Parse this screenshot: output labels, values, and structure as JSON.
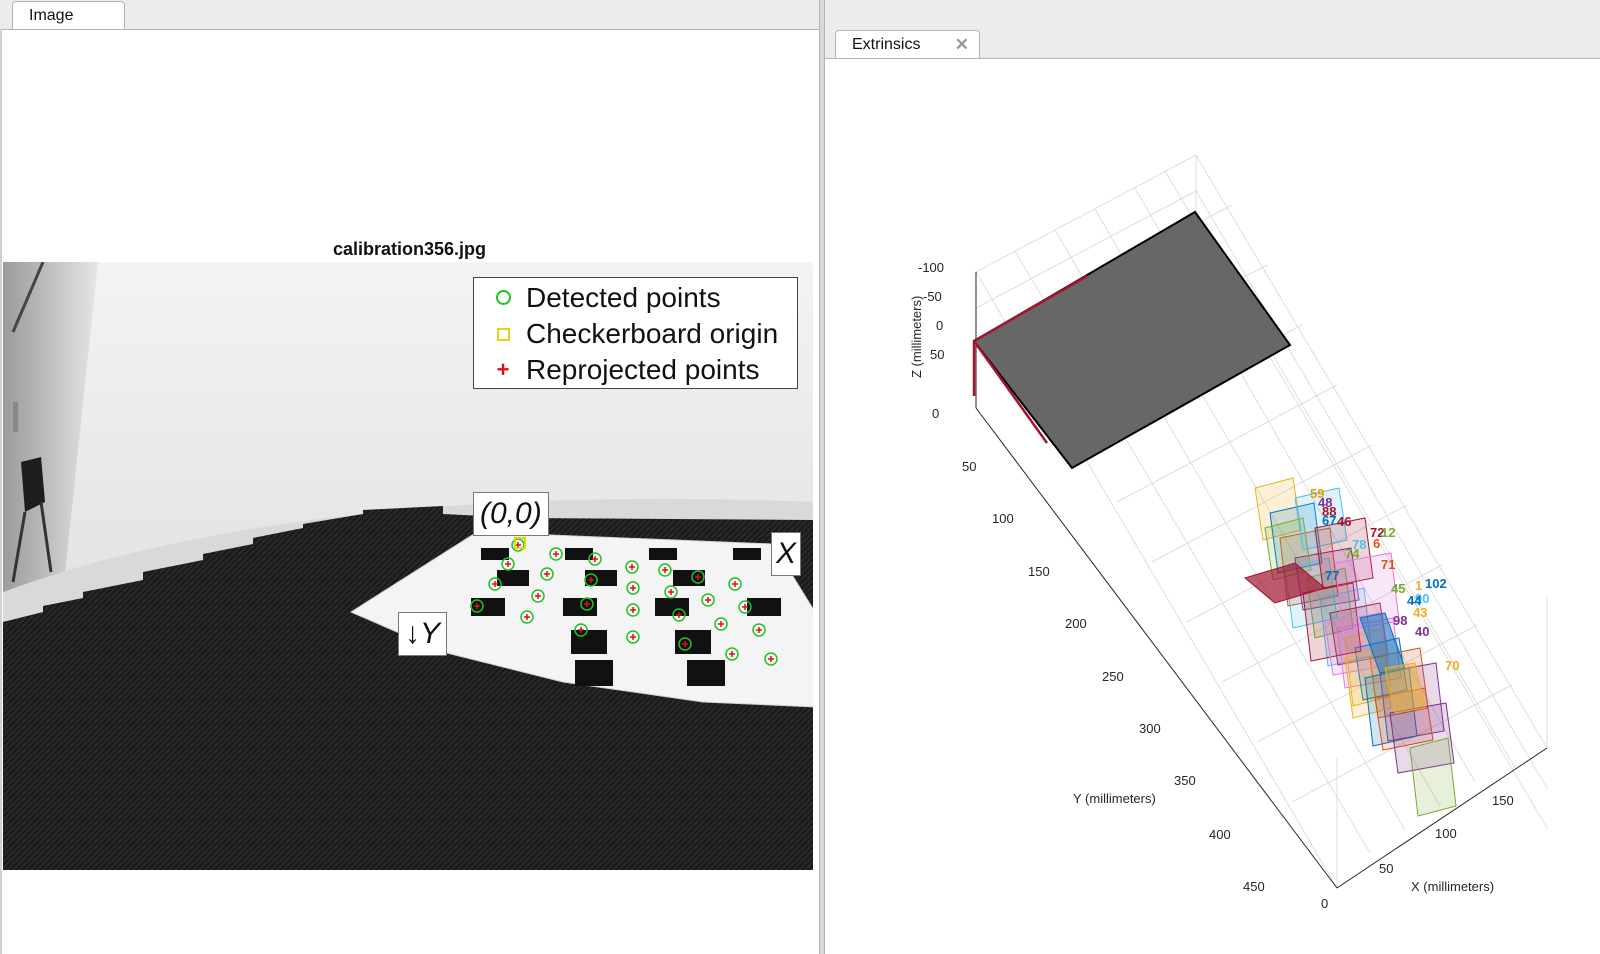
{
  "left_tab": {
    "label": "Image"
  },
  "right_tab": {
    "label": "Extrinsics"
  },
  "image_view": {
    "title": "calibration356.jpg",
    "legend": {
      "detected": "Detected points",
      "origin": "Checkerboard origin",
      "reprojected": "Reprojected points"
    },
    "origin_label": "(0,0)",
    "x_label": "X",
    "y_label": "↓Y"
  },
  "extrinsics_plot": {
    "z_label": "Z (millimeters)",
    "y_label": "Y (millimeters)",
    "x_label": "X (millimeters)",
    "z_ticks": [
      "-100",
      "-50",
      "0",
      "50",
      "0"
    ],
    "y_ticks": [
      "50",
      "100",
      "150",
      "200",
      "250",
      "300",
      "350",
      "400",
      "450"
    ],
    "x_ticks": [
      "0",
      "50",
      "100",
      "150"
    ],
    "camera_labels": [
      {
        "t": "59",
        "c": "#e0a000"
      },
      {
        "t": "48",
        "c": "#7e2f8e"
      },
      {
        "t": "88",
        "c": "#a2142f"
      },
      {
        "t": "67",
        "c": "#0072bd"
      },
      {
        "t": "46",
        "c": "#a2142f"
      },
      {
        "t": "72",
        "c": "#a2142f"
      },
      {
        "t": "12",
        "c": "#77ac30"
      },
      {
        "t": "78",
        "c": "#4dbeee"
      },
      {
        "t": "6",
        "c": "#d95319"
      },
      {
        "t": "74",
        "c": "#77ac30"
      },
      {
        "t": "71",
        "c": "#d95319"
      },
      {
        "t": "77",
        "c": "#0072bd"
      },
      {
        "t": "45",
        "c": "#77ac30"
      },
      {
        "t": "1",
        "c": "#edb120"
      },
      {
        "t": "102",
        "c": "#0072bd"
      },
      {
        "t": "90",
        "c": "#4dbeee"
      },
      {
        "t": "44",
        "c": "#0072bd"
      },
      {
        "t": "43",
        "c": "#edb120"
      },
      {
        "t": "98",
        "c": "#7e2f8e"
      },
      {
        "t": "40",
        "c": "#7e2f8e"
      },
      {
        "t": "70",
        "c": "#edb120"
      }
    ]
  },
  "colors": {
    "detected": "#1fc31f",
    "origin": "#e7d20b",
    "reprojected": "#d3141a",
    "board_gray": "#676767",
    "camera_axis": "#a2142f"
  }
}
